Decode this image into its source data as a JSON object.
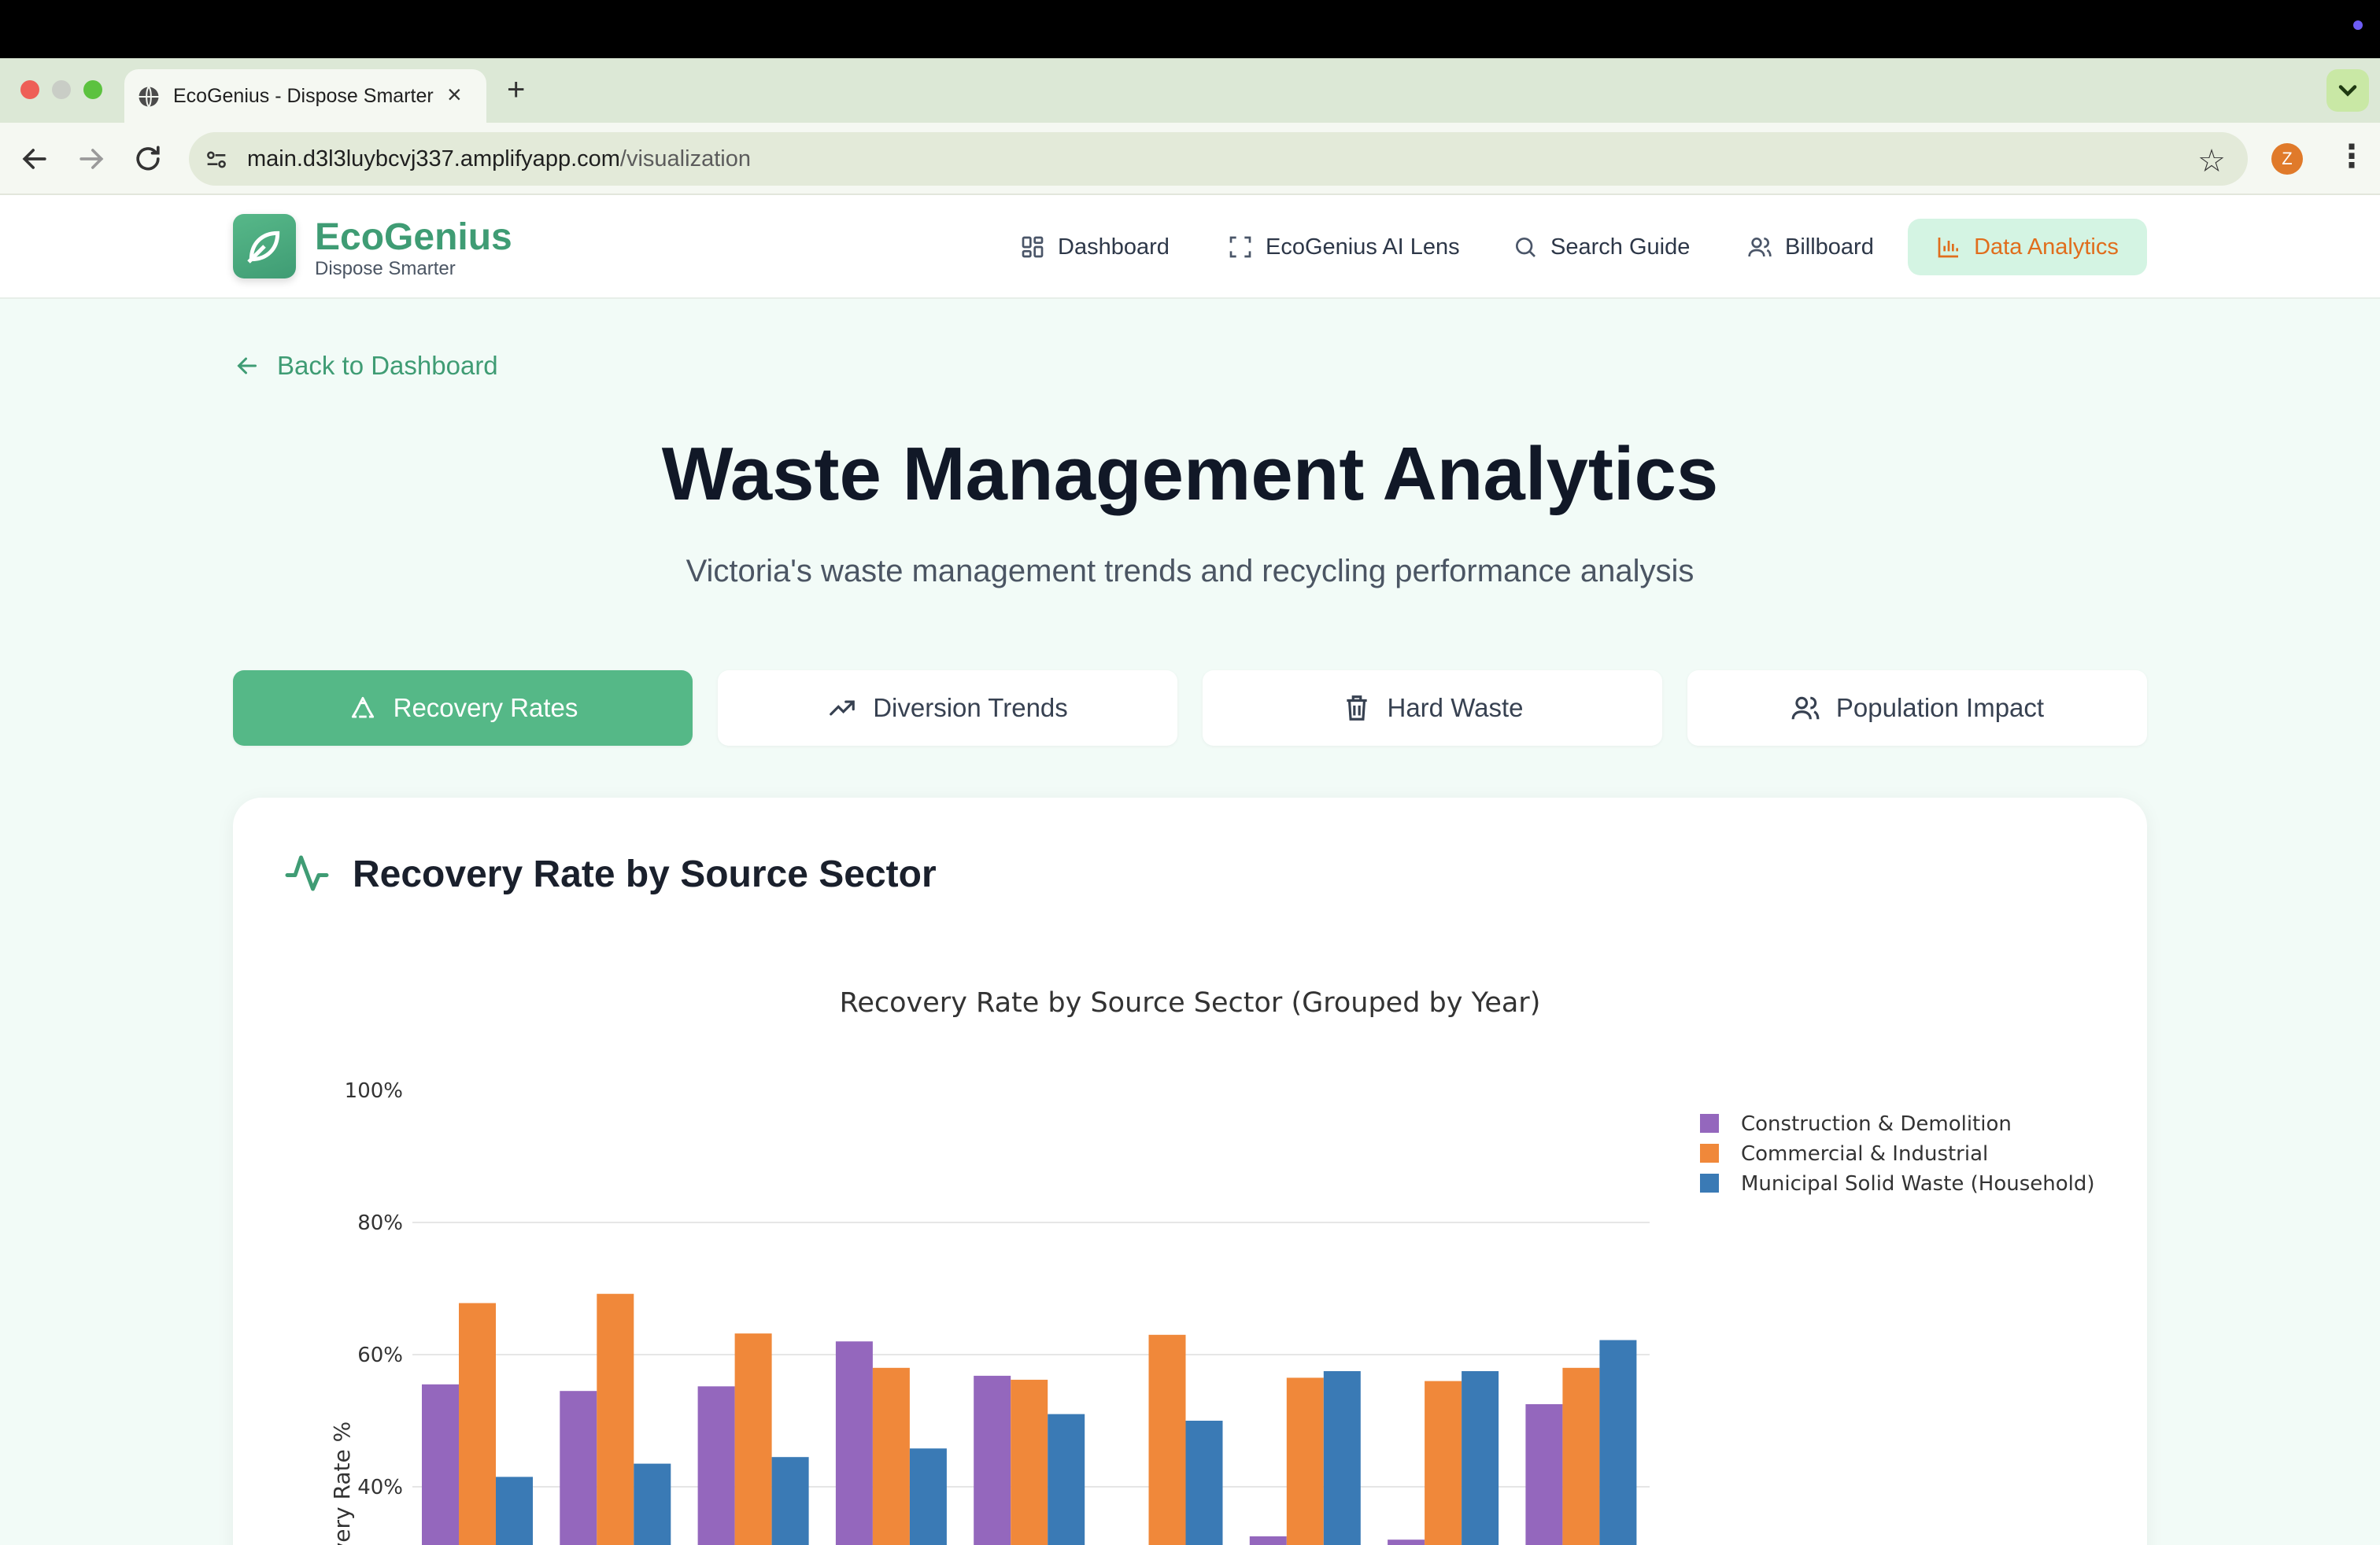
{
  "browser": {
    "tab_title": "EcoGenius - Dispose Smarter",
    "url_domain": "main.d3l3luybcvj337.amplifyapp.com",
    "url_path": "/visualization",
    "profile_initial": "Z"
  },
  "header": {
    "brand": "EcoGenius",
    "tagline": "Dispose Smarter",
    "nav": [
      {
        "label": "Dashboard",
        "icon": "grid-icon"
      },
      {
        "label": "EcoGenius AI Lens",
        "icon": "scan-icon"
      },
      {
        "label": "Search Guide",
        "icon": "search-icon"
      },
      {
        "label": "Billboard",
        "icon": "users-icon"
      },
      {
        "label": "Data Analytics",
        "icon": "bar-chart-icon",
        "active": true
      }
    ]
  },
  "page": {
    "back_label": "Back to Dashboard",
    "title": "Waste Management Analytics",
    "subtitle": "Victoria's waste management trends and recycling performance analysis"
  },
  "tabs": [
    {
      "label": "Recovery Rates",
      "icon": "recycle-icon",
      "active": true
    },
    {
      "label": "Diversion Trends",
      "icon": "trending-up-icon"
    },
    {
      "label": "Hard Waste",
      "icon": "trash-icon"
    },
    {
      "label": "Population Impact",
      "icon": "users-icon"
    }
  ],
  "card": {
    "title": "Recovery Rate by Source Sector",
    "icon": "activity-icon"
  },
  "colors": {
    "accent": "#55b887",
    "brand": "#3f9c74",
    "active_nav_text": "#e06d1c",
    "active_nav_bg": "#d4f4e3"
  },
  "chart_data": {
    "type": "bar",
    "title": "Recovery Rate by Source Sector (Grouped by Year)",
    "xlabel": "",
    "ylabel": "Recovery Rate %",
    "ylim": [
      20,
      100
    ],
    "yticks": [
      "40%",
      "60%",
      "80%",
      "100%"
    ],
    "grid": true,
    "legend_position": "top-right",
    "categories": [
      "",
      "",
      "",
      "",
      "",
      "",
      "",
      "",
      ""
    ],
    "series": [
      {
        "name": "Construction & Demolition",
        "color": "#9467bd",
        "values": [
          55.5,
          54.5,
          55.2,
          62,
          56.8,
          null,
          32.5,
          32,
          52.5
        ]
      },
      {
        "name": "Commercial & Industrial",
        "color": "#f0883a",
        "values": [
          67.8,
          69.2,
          63.2,
          58,
          56.2,
          63,
          56.5,
          56,
          58
        ]
      },
      {
        "name": "Municipal Solid Waste (Household)",
        "color": "#3a7ab5",
        "values": [
          41.5,
          43.5,
          44.5,
          45.8,
          51,
          50,
          57.5,
          57.5,
          62.2
        ]
      }
    ]
  }
}
